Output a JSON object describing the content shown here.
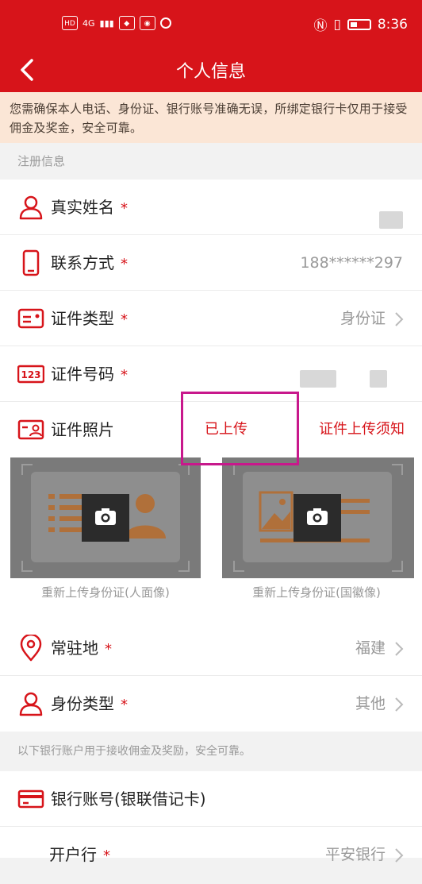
{
  "status_bar": {
    "hd_label": "HD",
    "signal_label": "4G",
    "time": "8:36"
  },
  "navbar": {
    "title": "个人信息"
  },
  "notice": {
    "text": "您需确保本人电话、身份证、银行账号准确无误，所绑定银行卡仅用于接受佣金及奖金，安全可靠。"
  },
  "section1": {
    "label": "注册信息"
  },
  "fields": {
    "real_name": {
      "label": "真实姓名",
      "required": "*"
    },
    "contact": {
      "label": "联系方式",
      "required": "*",
      "value": "188******297"
    },
    "id_type": {
      "label": "证件类型",
      "required": "*",
      "value": "身份证"
    },
    "id_number": {
      "label": "证件号码",
      "required": "*"
    },
    "id_photo": {
      "label": "证件照片",
      "status": "已上传",
      "link": "证件上传须知"
    },
    "residence": {
      "label": "常驻地",
      "required": "*",
      "value": "福建"
    },
    "identity_type": {
      "label": "身份类型",
      "required": "*",
      "value": "其他"
    }
  },
  "id_photos": {
    "front_caption": "重新上传身份证(人面像)",
    "back_caption": "重新上传身份证(国徽像)"
  },
  "section2": {
    "label": "以下银行账户用于接收佣金及奖励，安全可靠。"
  },
  "bank": {
    "title": "银行账号(银联借记卡)",
    "open_bank_label": "开户行",
    "open_bank_required": "*",
    "open_bank_value": "平安银行"
  },
  "colors": {
    "brand_red": "#d7141a",
    "notice_bg": "#fbe6d6",
    "highlight": "#c8188c"
  }
}
